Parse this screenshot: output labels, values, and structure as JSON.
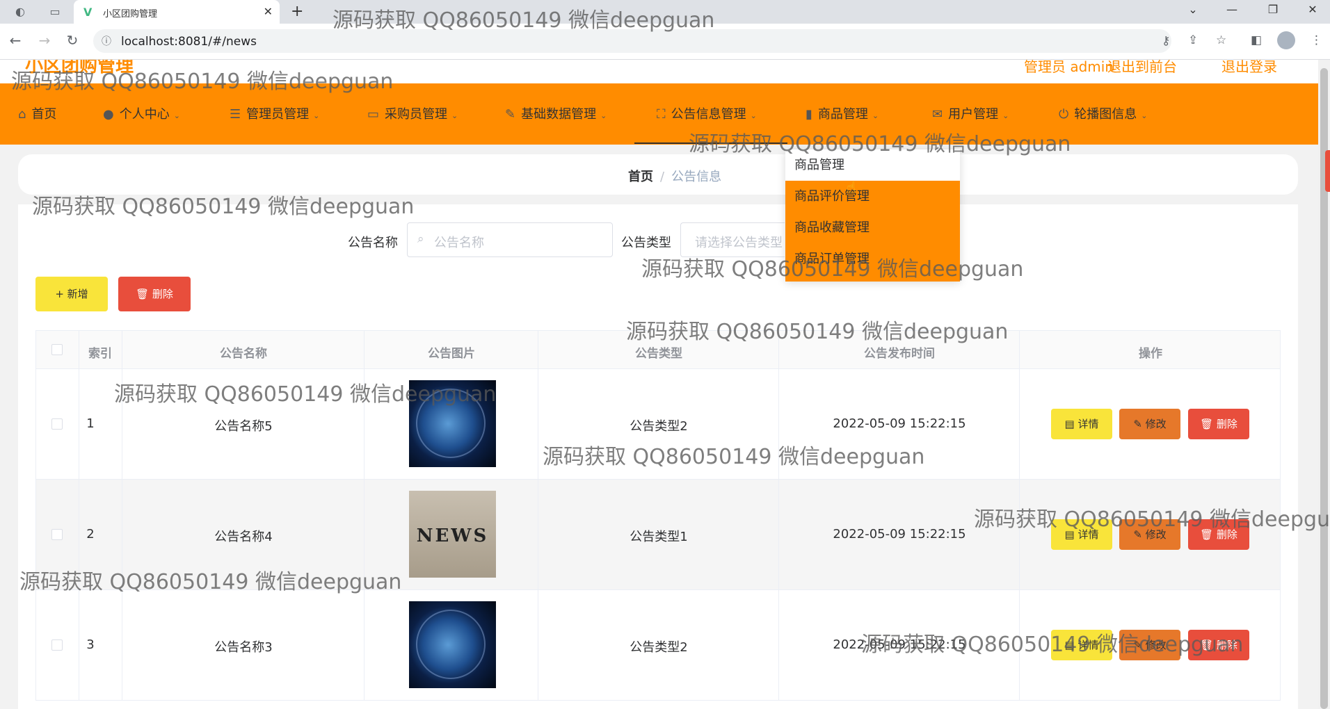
{
  "browser": {
    "tab_title": "小区团购管理",
    "url": "localhost:8081/#/news"
  },
  "app": {
    "logo": "小区团购管理",
    "top_links": [
      "管理员 admin",
      "退出到前台",
      "退出登录"
    ]
  },
  "menu": {
    "items": [
      {
        "label": "首页",
        "icon": "home-icon"
      },
      {
        "label": "个人中心",
        "icon": "user-icon"
      },
      {
        "label": "管理员管理",
        "icon": "list-icon"
      },
      {
        "label": "采购员管理",
        "icon": "message-icon"
      },
      {
        "label": "基础数据管理",
        "icon": "edit-icon"
      },
      {
        "label": "公告信息管理",
        "icon": "fullscreen-icon"
      },
      {
        "label": "商品管理",
        "icon": "chart-icon"
      },
      {
        "label": "用户管理",
        "icon": "mail-icon"
      },
      {
        "label": "轮播图信息",
        "icon": "power-icon"
      }
    ],
    "dropdown": [
      "商品管理",
      "商品评价管理",
      "商品收藏管理",
      "商品订单管理"
    ]
  },
  "breadcrumb": {
    "home": "首页",
    "current": "公告信息"
  },
  "search": {
    "name_label": "公告名称",
    "name_placeholder": "公告名称",
    "type_label": "公告类型",
    "type_placeholder": "请选择公告类型"
  },
  "actions": {
    "add": "新增",
    "delete": "删除"
  },
  "table": {
    "headers": [
      "索引",
      "公告名称",
      "公告图片",
      "公告类型",
      "公告发布时间",
      "操作"
    ],
    "rows": [
      {
        "index": "1",
        "name": "公告名称5",
        "image": "globe",
        "type": "公告类型2",
        "time": "2022-05-09 15:22:15"
      },
      {
        "index": "2",
        "name": "公告名称4",
        "image": "news",
        "type": "公告类型1",
        "time": "2022-05-09 15:22:15"
      },
      {
        "index": "3",
        "name": "公告名称3",
        "image": "globe",
        "type": "公告类型2",
        "time": "2022-05-09 15:22:15"
      }
    ],
    "op_labels": {
      "detail": "详情",
      "edit": "修改",
      "delete": "删除"
    },
    "news_image_text": "NEWS"
  },
  "watermark": "源码获取 QQ86050149 微信deepguan",
  "colors": {
    "accent": "#ff8c00",
    "btn_yellow": "#f9e43a",
    "btn_orange": "#e6782a",
    "btn_red": "#e84e3c"
  }
}
